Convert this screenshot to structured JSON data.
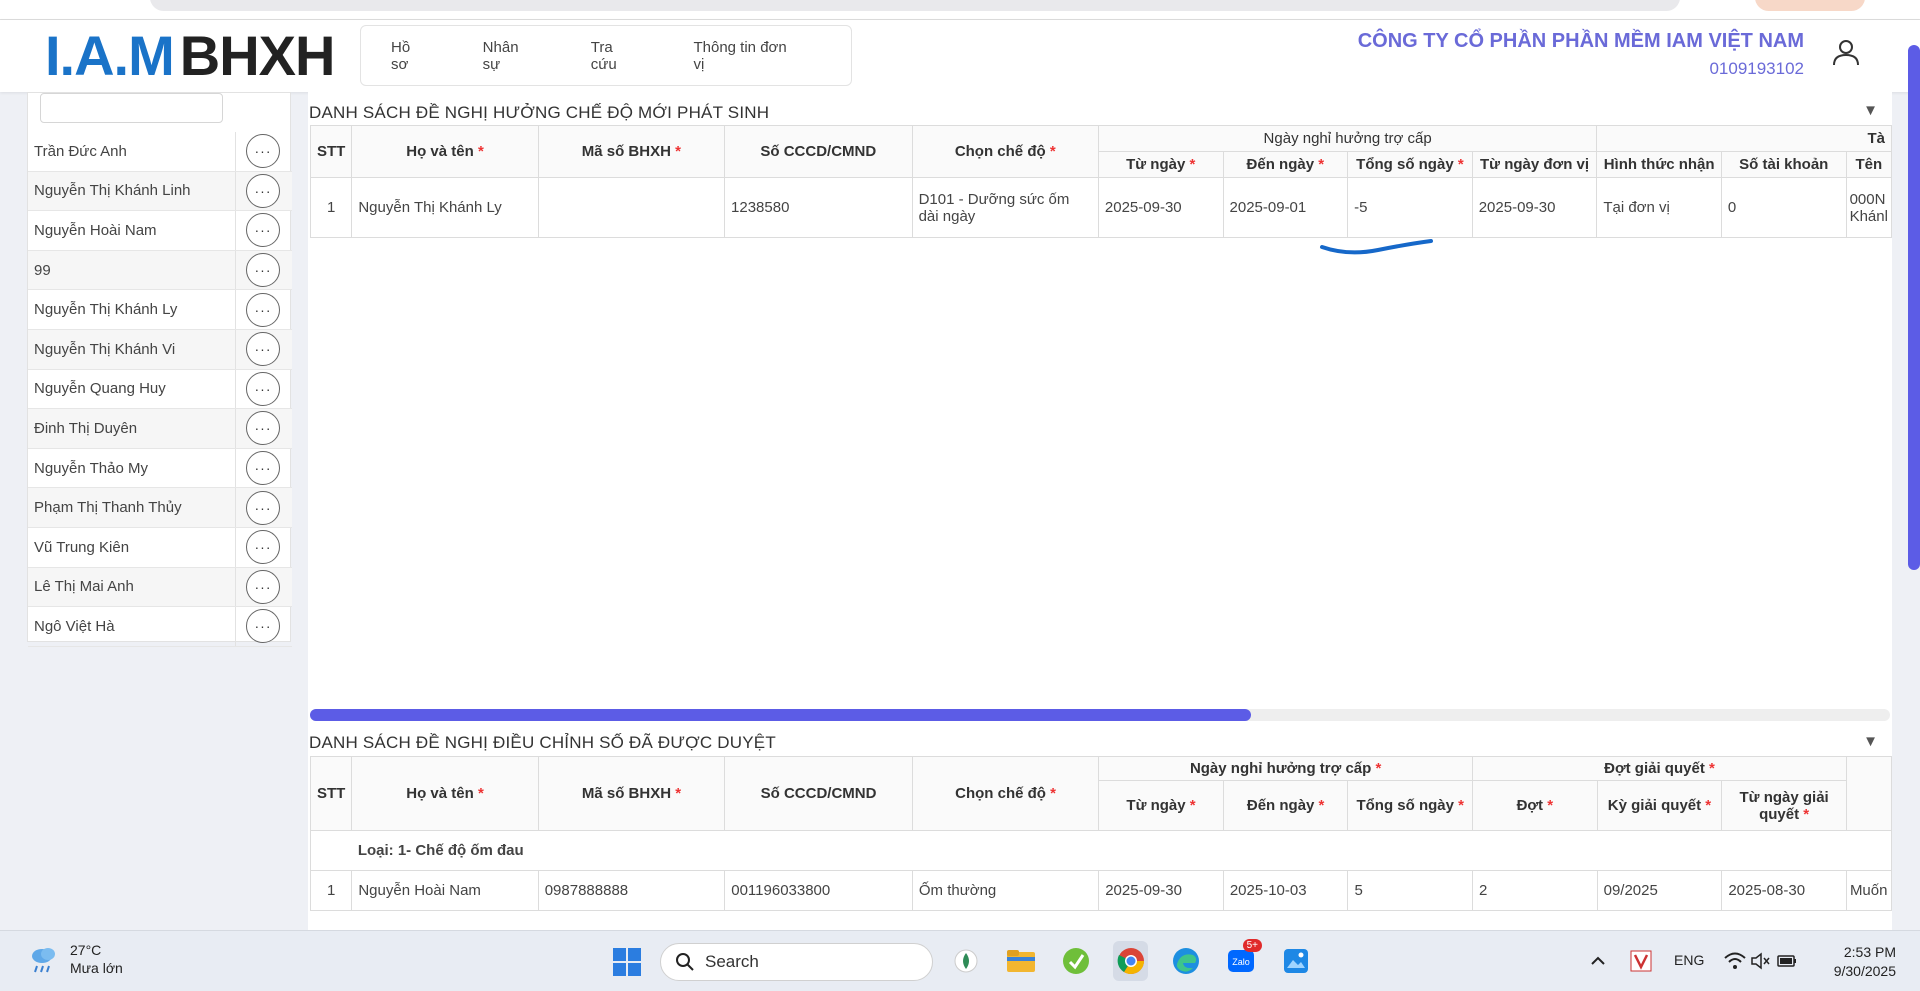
{
  "header": {
    "logo_iam": "I.A.M",
    "logo_bhxh": "BHXH",
    "nav": [
      "Hồ sơ",
      "Nhân sự",
      "Tra cứu",
      "Thông tin đơn vị"
    ],
    "company_name": "CÔNG TY CỔ PHẦN PHẦN MỀM IAM VIỆT NAM",
    "tax_code": "0109193102"
  },
  "sidebar": {
    "people": [
      "Trần Đức Anh",
      "Nguyễn Thị Khánh Linh",
      "Nguyễn Hoài Nam",
      "99",
      "Nguyễn Thị Khánh Ly",
      "Nguyễn Thị Khánh Vi",
      "Nguyễn Quang Huy",
      "Đinh Thị Duyên",
      "Nguyễn Thảo My",
      "Phạm Thị Thanh Thủy",
      "Vũ Trung Kiên",
      "Lê Thị Mai Anh",
      "Ngô Việt Hà"
    ],
    "more_symbol": "···"
  },
  "section1": {
    "title": "DANH SÁCH ĐỀ NGHỊ HƯỞNG CHẾ ĐỘ MỚI PHÁT SINH",
    "collapse": "▼",
    "headers": {
      "stt": "STT",
      "ho_ten": "Họ và tên",
      "ma_bhxh": "Mã số BHXH",
      "cccd": "Số CCCD/CMND",
      "che_do": "Chọn chế độ",
      "group_ngay": "Ngày nghỉ hưởng trợ cấp",
      "tu_ngay": "Từ ngày",
      "den_ngay": "Đến ngày",
      "tong_ngay": "Tổng số ngày",
      "tu_ngay_dv": "Từ ngày đơn vị",
      "hinh_thuc": "Hình thức nhận",
      "so_tk": "Số tài khoản",
      "ten": "Tên",
      "group_cut": "Tà"
    },
    "row": {
      "stt": "1",
      "ho_ten": "Nguyễn Thị Khánh Ly",
      "ma_bhxh": "",
      "cccd": "1238580",
      "che_do": "D101 - Dưỡng sức ốm dài ngày",
      "tu_ngay": "2025-09-30",
      "den_ngay": "2025-09-01",
      "tong_ngay": "-5",
      "tu_ngay_dv": "2025-09-30",
      "hinh_thuc": "Tại đơn vị",
      "so_tk": "0",
      "ten": "000N Khánl"
    }
  },
  "section2": {
    "title": "DANH SÁCH ĐỀ NGHỊ ĐIỀU CHỈNH SỐ ĐÃ ĐƯỢC DUYỆT",
    "collapse": "▼",
    "headers": {
      "stt": "STT",
      "ho_ten": "Họ và tên",
      "ma_bhxh": "Mã số BHXH",
      "cccd": "Số CCCD/CMND",
      "che_do": "Chọn chế độ",
      "group_ngay": "Ngày nghỉ hưởng trợ cấp",
      "group_dot": "Đợt giải quyết",
      "tu_ngay": "Từ ngày",
      "den_ngay": "Đến ngày",
      "tong_ngay": "Tổng số ngày",
      "dot": "Đợt",
      "ky": "Kỳ giải quyết",
      "tu_ngay_gq": "Từ ngày giải quyết"
    },
    "group_label": "Loại: 1- Chế độ ốm đau",
    "row": {
      "stt": "1",
      "ho_ten": "Nguyễn Hoài Nam",
      "ma_bhxh": "0987888888",
      "cccd": "001196033800",
      "che_do": "Ốm thường",
      "tu_ngay": "2025-09-30",
      "den_ngay": "2025-10-03",
      "tong_ngay": "5",
      "dot": "2",
      "ky": "09/2025",
      "tu_ngay_gq": "2025-08-30",
      "extra": "Muốn"
    }
  },
  "taskbar": {
    "temp": "27°C",
    "weather": "Mưa lớn",
    "search": "Search",
    "badge": "5+",
    "lang": "ENG",
    "time": "2:53 PM",
    "date": "9/30/2025"
  },
  "colors": {
    "accent": "#5c5ce6",
    "logo_blue": "#1a73c8",
    "company_text": "#6a6ad8",
    "required": "#e33333",
    "annotation": "#1668c9"
  }
}
